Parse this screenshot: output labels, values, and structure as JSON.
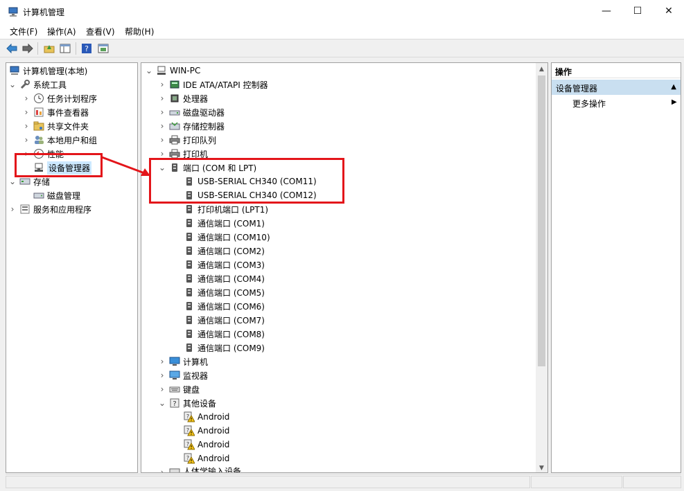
{
  "window": {
    "title": "计算机管理",
    "min_glyph": "—",
    "max_glyph": "☐",
    "close_glyph": "✕"
  },
  "menu": [
    {
      "label": "文件(F)"
    },
    {
      "label": "操作(A)"
    },
    {
      "label": "查看(V)"
    },
    {
      "label": "帮助(H)"
    }
  ],
  "toolbar": [
    "back-arrow-icon",
    "forward-arrow-icon",
    "up-folder-icon",
    "show-hide-tree-icon",
    "help-icon",
    "properties-icon"
  ],
  "left_tree": {
    "root": "计算机管理(本地)",
    "system_tools": "系统工具",
    "task_scheduler": "任务计划程序",
    "event_viewer": "事件查看器",
    "shared_folders": "共享文件夹",
    "local_users": "本地用户和组",
    "performance": "性能",
    "device_manager": "设备管理器",
    "storage": "存储",
    "disk_management": "磁盘管理",
    "services_apps": "服务和应用程序"
  },
  "device_tree": {
    "root": "WIN-PC",
    "ide": "IDE ATA/ATAPI 控制器",
    "processor": "处理器",
    "disk_drives": "磁盘驱动器",
    "storage_ctrl": "存储控制器",
    "print_queue": "打印队列",
    "printers": "打印机",
    "ports": "端口 (COM 和 LPT)",
    "port_items": [
      "USB-SERIAL CH340 (COM11)",
      "USB-SERIAL CH340 (COM12)",
      "打印机端口 (LPT1)",
      "通信端口 (COM1)",
      "通信端口 (COM10)",
      "通信端口 (COM2)",
      "通信端口 (COM3)",
      "通信端口 (COM4)",
      "通信端口 (COM5)",
      "通信端口 (COM6)",
      "通信端口 (COM7)",
      "通信端口 (COM8)",
      "通信端口 (COM9)"
    ],
    "computer": "计算机",
    "monitors": "监视器",
    "keyboards": "键盘",
    "other_devices": "其他设备",
    "other_items": [
      "Android",
      "Android",
      "Android",
      "Android"
    ],
    "hid": "人体学输入设备"
  },
  "actions": {
    "header": "操作",
    "section": "设备管理器",
    "more": "更多操作"
  },
  "colors": {
    "highlight": "#e3151a",
    "selection": "#cce8ff",
    "action_section": "#c9dff0"
  }
}
